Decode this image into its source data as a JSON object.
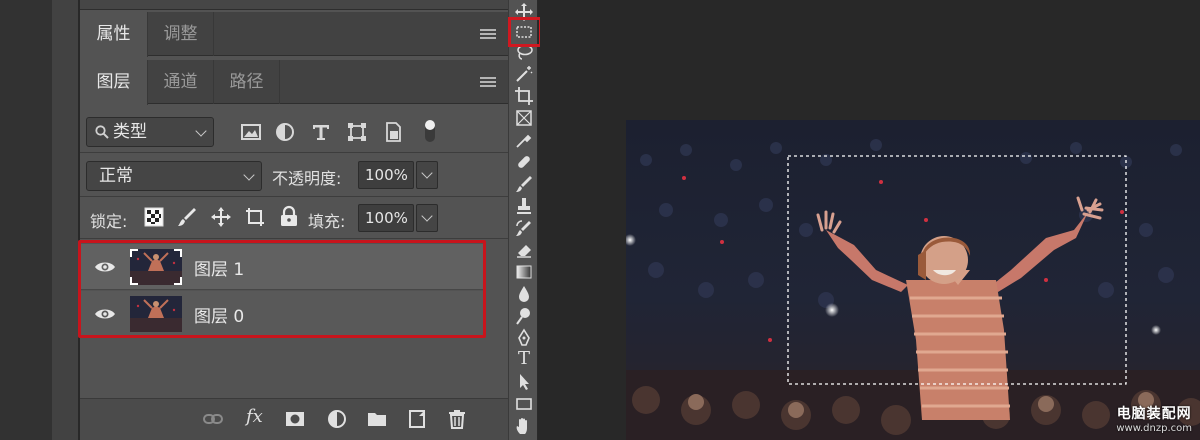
{
  "properties_panel": {
    "tabs": [
      {
        "label": "属性",
        "active": true
      },
      {
        "label": "调整",
        "active": false
      }
    ]
  },
  "layers_panel": {
    "tabs": [
      {
        "label": "图层",
        "active": true
      },
      {
        "label": "通道",
        "active": false
      },
      {
        "label": "路径",
        "active": false
      }
    ],
    "filter": {
      "value": "类型",
      "icon": "search-icon"
    },
    "filter_icons": [
      "image-filter-icon",
      "adjustment-filter-icon",
      "type-filter-icon",
      "shape-filter-icon",
      "smart-object-filter-icon",
      "filter-toggle-icon"
    ],
    "blend_mode": {
      "value": "正常"
    },
    "opacity": {
      "label": "不透明度:",
      "value": "100%"
    },
    "lock": {
      "label": "锁定:",
      "icons": [
        "lock-transparency-icon",
        "lock-image-icon",
        "lock-position-icon",
        "lock-artboard-icon",
        "lock-all-icon"
      ]
    },
    "fill": {
      "label": "填充:",
      "value": "100%"
    },
    "layers": [
      {
        "name": "图层 1",
        "visible": true,
        "selected": true
      },
      {
        "name": "图层 0",
        "visible": true,
        "selected": false
      }
    ],
    "bottom_icons": [
      "link-layers-icon",
      "fx-icon",
      "add-mask-icon",
      "new-adjustment-layer-icon",
      "new-group-icon",
      "new-layer-icon",
      "delete-layer-icon"
    ],
    "fx_label": "fx"
  },
  "toolbar": {
    "tools": [
      "move-tool-icon",
      "rectangular-marquee-tool-icon",
      "lasso-tool-icon",
      "magic-wand-tool-icon",
      "crop-tool-icon",
      "frame-tool-icon",
      "eyedropper-tool-icon",
      "healing-brush-tool-icon",
      "brush-tool-icon",
      "clone-stamp-tool-icon",
      "history-brush-tool-icon",
      "eraser-tool-icon",
      "gradient-tool-icon",
      "blur-tool-icon",
      "dodge-tool-icon",
      "pen-tool-icon",
      "type-tool-icon",
      "path-selection-tool-icon",
      "rectangle-tool-icon",
      "hand-tool-icon"
    ],
    "type_tool_glyph": "T",
    "active_tool": "rectangular-marquee-tool-icon"
  },
  "watermark": {
    "main": "电脑装配网",
    "sub": "www.dnzp.com"
  },
  "colors": {
    "highlight": "#c8141c",
    "panel": "#535353",
    "canvas_bg": "#282828"
  }
}
